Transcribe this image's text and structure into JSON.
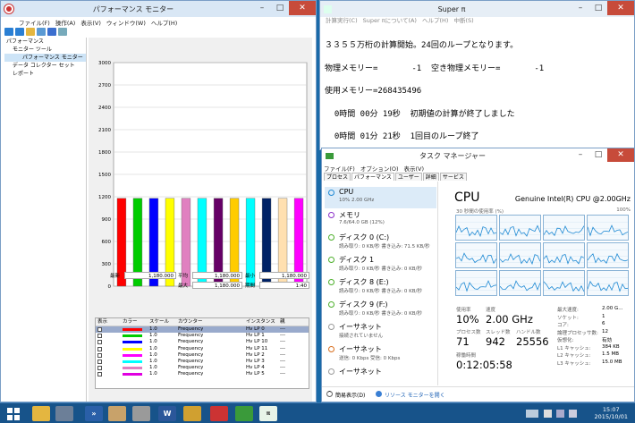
{
  "perfmon": {
    "title": "パフォーマンス モニター",
    "menu": [
      "ファイル(F)",
      "操作(A)",
      "表示(V)",
      "ウィンドウ(W)",
      "ヘルプ(H)"
    ],
    "tree": [
      {
        "label": "パフォーマンス",
        "indent": 0
      },
      {
        "label": "モニター ツール",
        "indent": 1
      },
      {
        "label": "パフォーマンス モニター",
        "indent": 2
      },
      {
        "label": "データ コレクター セット",
        "indent": 1
      },
      {
        "label": "レポート",
        "indent": 1
      }
    ],
    "chart": {
      "ymax_label": "3000",
      "ylabels": [
        "2700",
        "2400",
        "2100",
        "1800",
        "1500",
        "1200",
        "900",
        "600",
        "300",
        "0"
      ]
    },
    "stats": {
      "last_label": "最新",
      "last": "1,180.000",
      "avg_label": "平均",
      "avg": "1,180.000",
      "min_label": "最小",
      "min": "1,180.000",
      "max_label": "最大",
      "max": "1,180.000",
      "dur_label": "期間",
      "dur": "1:40"
    },
    "table": {
      "headers": [
        "表示",
        "カラー",
        "スケール",
        "カウンター",
        "インスタンス",
        "親"
      ],
      "rows": [
        {
          "scale": "1.0",
          "counter": "Frequency",
          "instance": "Hv LP 0",
          "parent": "---",
          "color": "#ff0000"
        },
        {
          "scale": "1.0",
          "counter": "Frequency",
          "instance": "Hv LP 1",
          "parent": "---",
          "color": "#00cc00"
        },
        {
          "scale": "1.0",
          "counter": "Frequency",
          "instance": "Hv LP 10",
          "parent": "---",
          "color": "#0000ff"
        },
        {
          "scale": "1.0",
          "counter": "Frequency",
          "instance": "Hv LP 11",
          "parent": "---",
          "color": "#ffff00"
        },
        {
          "scale": "1.0",
          "counter": "Frequency",
          "instance": "Hv LP 2",
          "parent": "---",
          "color": "#ff00ff"
        },
        {
          "scale": "1.0",
          "counter": "Frequency",
          "instance": "Hv LP 3",
          "parent": "---",
          "color": "#00ffff"
        },
        {
          "scale": "1.0",
          "counter": "Frequency",
          "instance": "Hv LP 4",
          "parent": "---",
          "color": "#e080c0"
        },
        {
          "scale": "1.0",
          "counter": "Frequency",
          "instance": "Hv LP 5",
          "parent": "---",
          "color": "#e000e0"
        }
      ]
    }
  },
  "chart_data": {
    "type": "bar",
    "ylim": [
      0,
      3000
    ],
    "yticks": [
      0,
      300,
      600,
      900,
      1200,
      1500,
      1800,
      2100,
      2400,
      2700,
      3000
    ],
    "values": [
      1180,
      1180,
      1180,
      1180,
      1180,
      1180,
      1180,
      1180,
      1180,
      1180,
      1180,
      1180
    ],
    "colors": [
      "#ff0000",
      "#00cc00",
      "#0000ff",
      "#ffff00",
      "#e080c0",
      "#00ffff",
      "#660066",
      "#ffcc00",
      "#00ffff",
      "#002266",
      "#ffe0b0",
      "#ff00ff"
    ]
  },
  "supern": {
    "title": "Super π",
    "menu": [
      "計算実行(C)",
      "Super πについて(A)",
      "ヘルプ(H)",
      "中断(S)"
    ],
    "lines": [
      "３３５５万桁の計算開始。24回のループとなります。",
      "物理メモリー=       -1  空き物理メモリー=       -1",
      "使用メモリー=268435496",
      "  0時間 00分 19秒  初期値の計算が終了しました",
      "  0時間 01分 21秒  1回目のループ終了"
    ]
  },
  "taskmgr": {
    "title": "タスク マネージャー",
    "menu": [
      "ファイル(F)",
      "オプション(O)",
      "表示(V)"
    ],
    "tabs": [
      "プロセス",
      "パフォーマンス",
      "ユーザー",
      "詳細",
      "サービス"
    ],
    "resources": [
      {
        "name": "CPU",
        "sub": "10%  2.00 GHz",
        "color": "#1f8ad4"
      },
      {
        "name": "メモリ",
        "sub": "7.6/64.0 GB (12%)",
        "color": "#8b2fc9"
      },
      {
        "name": "ディスク 0 (C:)",
        "sub": "読み取り: 0 KB/秒  書き込み: 71.5 KB/秒",
        "color": "#4caf2a"
      },
      {
        "name": "ディスク 1",
        "sub": "読み取り: 0 KB/秒  書き込み: 0 KB/秒",
        "color": "#4caf2a"
      },
      {
        "name": "ディスク 8 (E:)",
        "sub": "読み取り: 0 KB/秒  書き込み: 0 KB/秒",
        "color": "#4caf2a"
      },
      {
        "name": "ディスク 9 (F:)",
        "sub": "読み取り: 0 KB/秒  書き込み: 0 KB/秒",
        "color": "#4caf2a"
      },
      {
        "name": "イーサネット",
        "sub": "接続されていません",
        "color": "#999999"
      },
      {
        "name": "イーサネット",
        "sub": "送信: 0 Kbps  受信: 0 Kbps",
        "color": "#d86f1f"
      },
      {
        "name": "イーサネット",
        "sub": "",
        "color": "#999999"
      }
    ],
    "cpu": {
      "heading": "CPU",
      "model": "Genuine Intel(R) CPU @2.00GHz",
      "graph_label": "30 秒間の使用率 (%)",
      "graph_max": "100%",
      "util_label": "使用率",
      "util": "10%",
      "speed_label": "速度",
      "speed": "2.00 GHz",
      "proc_label": "プロセス数",
      "proc": "71",
      "thr_label": "スレッド数",
      "thr": "942",
      "hdl_label": "ハンドル数",
      "hdl": "25556",
      "up_label": "稼働時間",
      "up": "0:12:05:58",
      "right": [
        {
          "k": "最大速度:",
          "v": "2.00 G..."
        },
        {
          "k": "ソケット:",
          "v": "1"
        },
        {
          "k": "コア:",
          "v": "6"
        },
        {
          "k": "論理プロセッサ数:",
          "v": "12"
        },
        {
          "k": "仮想化:",
          "v": "有効"
        },
        {
          "k": "L1 キャッシュ:",
          "v": "384 KB"
        },
        {
          "k": "L2 キャッシュ:",
          "v": "1.5 MB"
        },
        {
          "k": "L3 キャッシュ:",
          "v": "15.0 MB"
        }
      ]
    },
    "footer": {
      "simple": "簡易表示(D)",
      "resmon": "リソース モニターを開く"
    }
  },
  "clock": {
    "time": "15:07",
    "date": "2015/10/01"
  }
}
